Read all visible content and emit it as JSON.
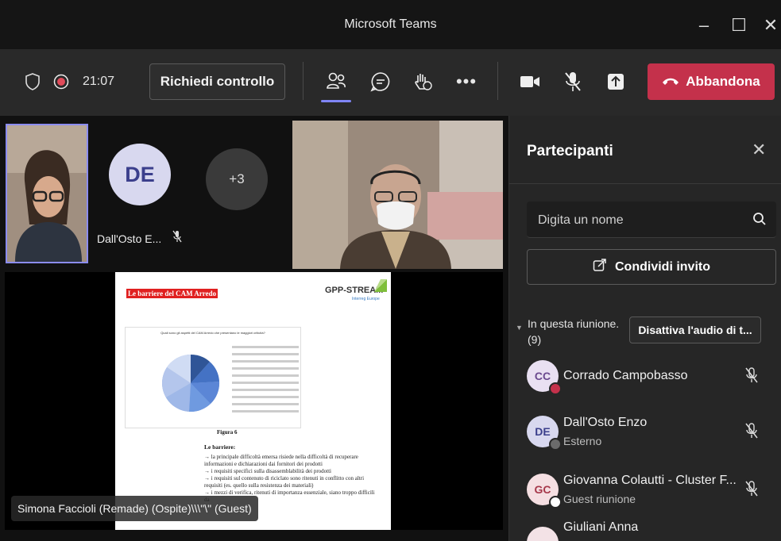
{
  "window": {
    "title": "Microsoft Teams",
    "controls": [
      "–",
      "☐",
      "✕"
    ]
  },
  "toolbar": {
    "timer": "21:07",
    "request_control": "Richiedi controllo",
    "leave": "Abbandona",
    "colors": {
      "leave_bg": "#c4314b",
      "record": "#e04b5a",
      "active_indicator": "#7f85f5"
    },
    "icons": [
      "shield-icon",
      "record-icon",
      "people-icon",
      "chat-icon",
      "raise-hand-icon",
      "more-icon",
      "camera-icon",
      "mic-off-icon",
      "share-icon",
      "phone-icon"
    ]
  },
  "stage": {
    "tiles": [
      {
        "initials": "DE",
        "name": "Dall'Osto E..."
      },
      {
        "label": "+3"
      }
    ],
    "document": {
      "heading": "Le barriere del CAM Arredo",
      "logo": "GPP-STREAM",
      "logo_sub": "Interreg Europe",
      "chart_title": "Quali sono gli aspetti del CAM Arredo che presentano le maggiori criticità?",
      "figure": "Figura 6",
      "section": "Le barriere:",
      "paragraphs": [
        "→ la principale difficoltà emersa risiede nella difficoltà di recuperare informazioni e dichiarazioni dai fornitori dei prodotti",
        "→ i requisiti specifici sulla disassemblabilità dei prodotti",
        "→ i requisiti sul contenuto di riciclato sono ritenuti in conflitto con altri requisiti (es. quello sulla resistenza dei materiali)",
        "→ i mezzi di verifica, ritenuti di importanza essenziale, siano troppo difficili da"
      ]
    },
    "caption": "Simona Faccioli (Remade) (Ospite)\\\\\\\"\\\" (Guest)"
  },
  "panel": {
    "title": "Partecipanti",
    "search_placeholder": "Digita un nome",
    "share_invite": "Condividi invito",
    "section_label": "In questa riunione.",
    "section_count": "(9)",
    "mute_all": "Disattiva l'audio di t...",
    "participants": [
      {
        "initials": "CC",
        "name": "Corrado Campobasso",
        "sub": "",
        "avatar_bg": "#e9e0f2",
        "avatar_fg": "#6b4a8f",
        "badge": "#c4314b"
      },
      {
        "initials": "DE",
        "name": "Dall'Osto Enzo",
        "sub": "Esterno",
        "avatar_bg": "#d8d8ef",
        "avatar_fg": "#3b3f8c",
        "badge": "#6b6b6b"
      },
      {
        "initials": "GC",
        "name": "Giovanna Colautti - Cluster F...",
        "sub": "Guest riunione",
        "avatar_bg": "#f5dfe2",
        "avatar_fg": "#a6384a",
        "badge": "#ffffff"
      },
      {
        "initials": "GA",
        "name": "Giuliani Anna",
        "sub": "",
        "avatar_bg": "#f3e2e6",
        "avatar_fg": "#a6384a",
        "badge": ""
      }
    ]
  }
}
